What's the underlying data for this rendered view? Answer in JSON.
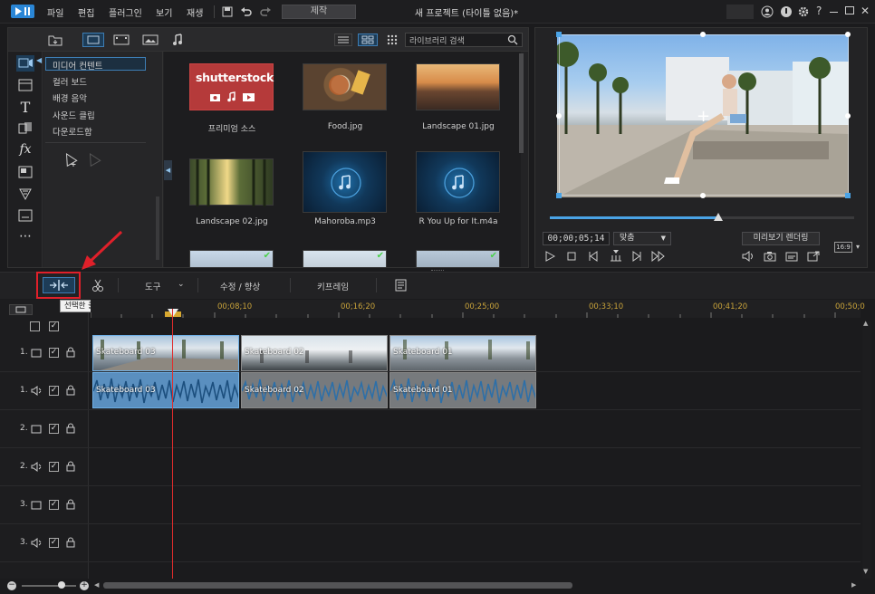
{
  "menu": [
    "파일",
    "편집",
    "플러그인",
    "보기",
    "재생"
  ],
  "produce_label": "제작",
  "project_title": "새 프로젝트 (타이틀 없음)*",
  "library": {
    "search_placeholder": "라이브러리 검색",
    "tree": [
      "미디어 컨텐트",
      "컬러 보드",
      "배경 음악",
      "사운드 클립",
      "다운로드함"
    ],
    "items": [
      {
        "label": "프리미엄 소스",
        "kind": "shutterstock",
        "brand": "shutterstock"
      },
      {
        "label": "Food.jpg",
        "kind": "image"
      },
      {
        "label": "Landscape 01.jpg",
        "kind": "image"
      },
      {
        "label": "Landscape 02.jpg",
        "kind": "image"
      },
      {
        "label": "Mahoroba.mp3",
        "kind": "music"
      },
      {
        "label": "R You Up for It.m4a",
        "kind": "music"
      }
    ]
  },
  "preview": {
    "timecode": "00;00;05;14",
    "fit_label": "맞춤",
    "render_label": "미리보기 렌더링",
    "ratio_label": "16:9",
    "scrub_progress": 0.55
  },
  "timeline_toolbar": {
    "tools_label": "도구",
    "fix_label": "수정 / 향상",
    "keyframe_label": "키프레임",
    "tooltip": "선택한 클립 분할 (Ctrl+T)"
  },
  "ruler": [
    "00;08;10",
    "00;16;20",
    "00;25;00",
    "00;33;10",
    "00;41;20",
    "00;50;0"
  ],
  "tracks": [
    {
      "num": "1.",
      "type": "video"
    },
    {
      "num": "1.",
      "type": "audio"
    },
    {
      "num": "2.",
      "type": "video"
    },
    {
      "num": "2.",
      "type": "audio"
    },
    {
      "num": "3.",
      "type": "video"
    },
    {
      "num": "3.",
      "type": "audio"
    }
  ],
  "clips": {
    "video": [
      "Skateboard 03",
      "Skateboard 02",
      "Skateboard 01"
    ],
    "audio": [
      "Skateboard 03",
      "Skateboard 02",
      "Skateboard 01"
    ]
  },
  "colors": {
    "accent": "#4aa3e6",
    "playhead": "#e02c2c",
    "highlight": "#e0202a"
  }
}
